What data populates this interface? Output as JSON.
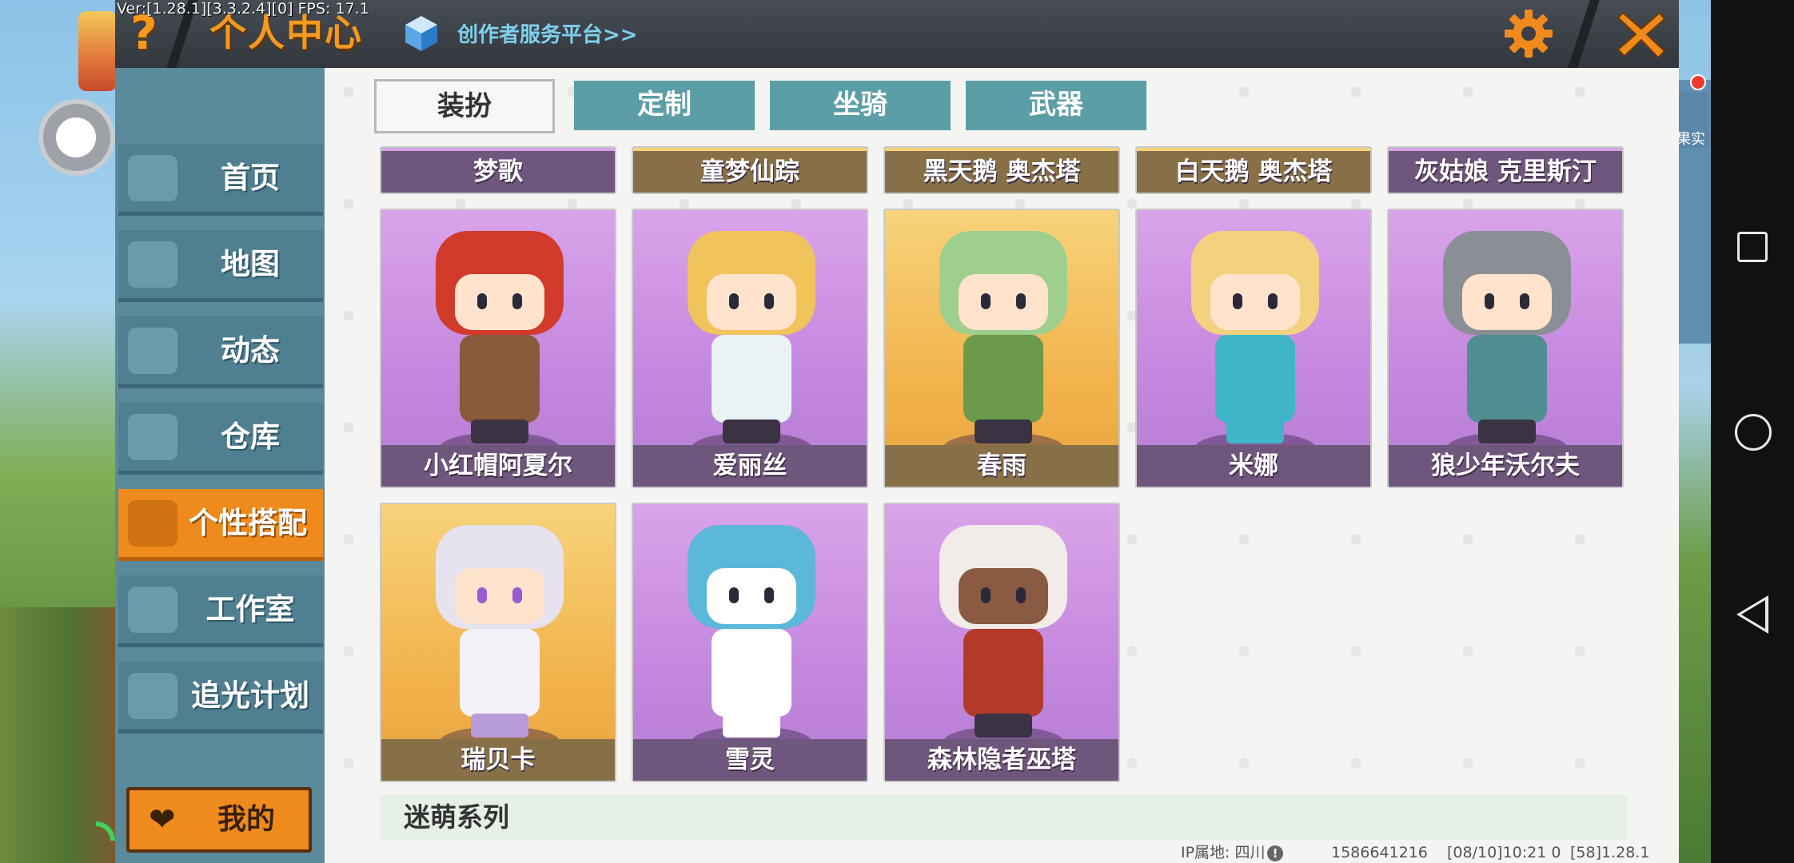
{
  "header": {
    "version": "Ver:[1.28.1][3.3.2.4][0] FPS: 17.1",
    "help_symbol": "?",
    "title": "个人中心",
    "creator_link": "创作者服务平台>>",
    "close_symbol": "✕"
  },
  "sidebar": {
    "items": [
      {
        "label": "首页",
        "icon": "house-icon"
      },
      {
        "label": "地图",
        "icon": "map-icon"
      },
      {
        "label": "动态",
        "icon": "bell-icon"
      },
      {
        "label": "仓库",
        "icon": "warehouse-icon"
      },
      {
        "label": "个性搭配",
        "icon": "outfit-icon",
        "active": true
      },
      {
        "label": "工作室",
        "icon": "studio-icon"
      },
      {
        "label": "追光计划",
        "icon": "sparkle-icon"
      }
    ],
    "my_button": "我的",
    "my_icon": "❤"
  },
  "tabs": [
    {
      "label": "装扮",
      "active": true
    },
    {
      "label": "定制"
    },
    {
      "label": "坐骑"
    },
    {
      "label": "武器"
    }
  ],
  "top_row": [
    "梦歌",
    "童梦仙踪",
    "黑天鹅 奥杰塔",
    "白天鹅 奥杰塔",
    "灰姑娘 克里斯汀"
  ],
  "skins": [
    {
      "name": "小红帽阿夏尔",
      "rarity": "purple"
    },
    {
      "name": "爱丽丝",
      "rarity": "purple"
    },
    {
      "name": "春雨",
      "rarity": "gold"
    },
    {
      "name": "米娜",
      "rarity": "purple"
    },
    {
      "name": "狼少年沃尔夫",
      "rarity": "purple"
    },
    {
      "name": "瑞贝卡",
      "rarity": "gold"
    },
    {
      "name": "雪灵",
      "rarity": "purple"
    },
    {
      "name": "森林隐者巫塔",
      "rarity": "purple"
    }
  ],
  "section_title": "迷萌系列",
  "status": {
    "ip": "IP属地: 四川",
    "uid": "1586641216",
    "time": "[08/10]10:21 0",
    "build": "[58]1.28.1"
  },
  "right_badge": "果实",
  "colors": {
    "accent_orange": "#ef8a1c",
    "tab_teal": "#5c9ea5",
    "sidebar_blue": "#4f7f91",
    "card_purple": "#c487de",
    "card_gold": "#f2b44e"
  }
}
